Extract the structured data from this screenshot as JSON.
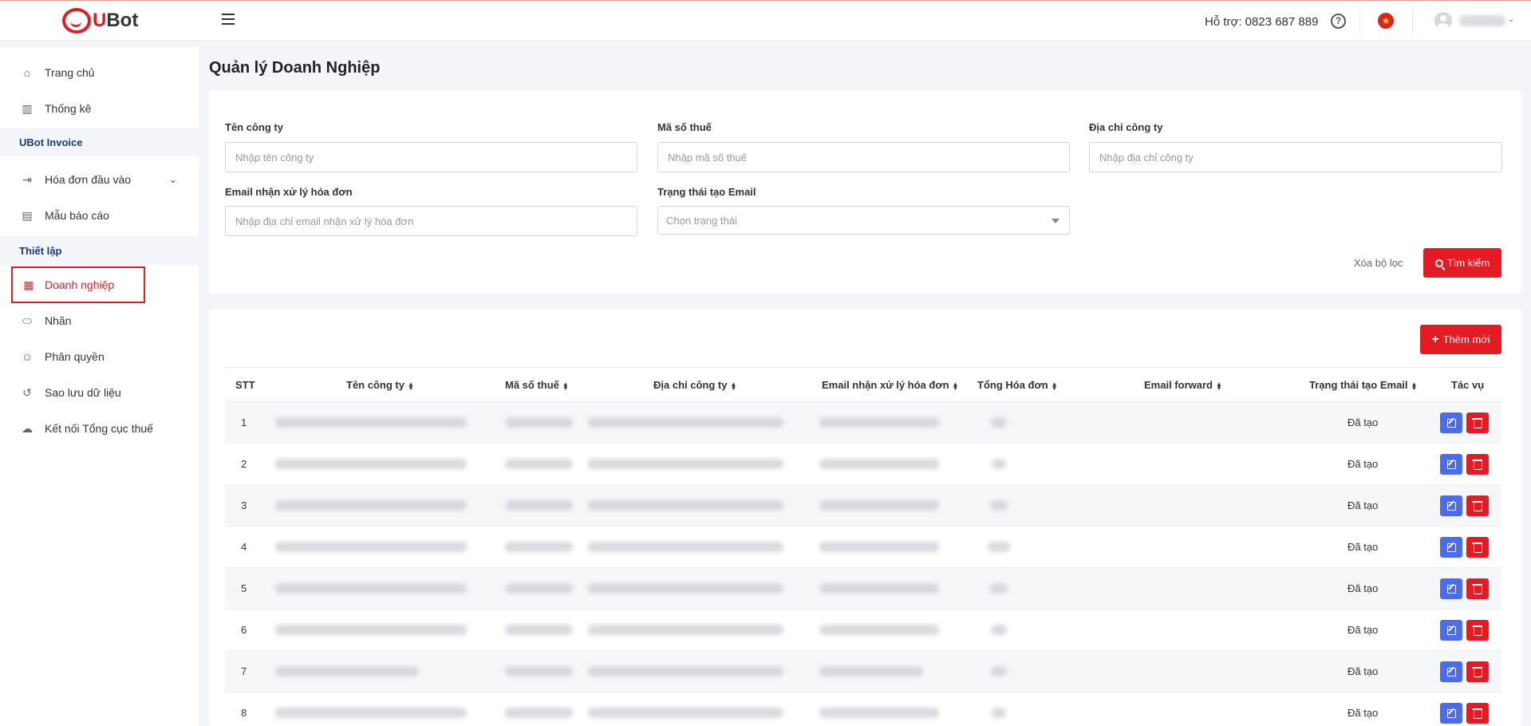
{
  "header": {
    "logo_text_u": "U",
    "logo_text_bot": "Bot",
    "support": "Hỗ trợ: 0823 687 889",
    "help_icon": "?"
  },
  "sidebar": {
    "items": [
      {
        "label": "Trang chủ",
        "icon": "home-icon"
      },
      {
        "label": "Thống kê",
        "icon": "chart-icon"
      },
      {
        "section": "UBot Invoice"
      },
      {
        "label": "Hóa đơn đầu vào",
        "icon": "arrow-in-icon"
      },
      {
        "label": "Mẫu báo cáo",
        "icon": "report-icon"
      },
      {
        "section": "Thiết lập"
      },
      {
        "label": "Doanh nghiệp",
        "icon": "building-icon"
      },
      {
        "label": "Nhãn",
        "icon": "tag-icon"
      },
      {
        "label": "Phân quyền",
        "icon": "user-permission-icon"
      },
      {
        "label": "Sao lưu dữ liệu",
        "icon": "history-icon"
      },
      {
        "label": "Kết nối Tổng cục thuế",
        "icon": "cloud-icon"
      }
    ]
  },
  "page": {
    "title": "Quản lý Doanh Nghiệp"
  },
  "filters": {
    "company_name": {
      "label": "Tên công ty",
      "placeholder": "Nhập tên công ty"
    },
    "tax_code": {
      "label": "Mã số thuế",
      "placeholder": "Nhập mã số thuế"
    },
    "address": {
      "label": "Địa chỉ công ty",
      "placeholder": "Nhập địa chỉ công ty"
    },
    "email": {
      "label": "Email nhận xử lý hóa đơn",
      "placeholder": "Nhập địa chỉ email nhận xử lý hóa đơn"
    },
    "email_status": {
      "label": "Trạng thái tạo Email",
      "placeholder": "Chọn trạng thái"
    },
    "clear_label": "Xóa bộ lọc",
    "search_label": "Tìm kiếm"
  },
  "table": {
    "add_label": "Thêm mới",
    "columns": [
      "STT",
      "Tên công ty",
      "Mã số thuế",
      "Địa chỉ công ty",
      "Email nhận xử lý hóa đơn",
      "Tổng Hóa đơn",
      "Email forward",
      "Trạng thái tạo Email",
      "Tác vụ"
    ],
    "rows": [
      {
        "stt": "1",
        "status": "Đã tạo"
      },
      {
        "stt": "2",
        "status": "Đã tạo"
      },
      {
        "stt": "3",
        "status": "Đã tạo"
      },
      {
        "stt": "4",
        "status": "Đã tạo"
      },
      {
        "stt": "5",
        "status": "Đã tạo"
      },
      {
        "stt": "6",
        "status": "Đã tạo"
      },
      {
        "stt": "7",
        "status": "Đã tạo"
      },
      {
        "stt": "8",
        "status": "Đã tạo"
      }
    ]
  },
  "colors": {
    "accent": "#e51b23",
    "edit": "#4a6cf0",
    "section_text": "#1b3b7a"
  }
}
